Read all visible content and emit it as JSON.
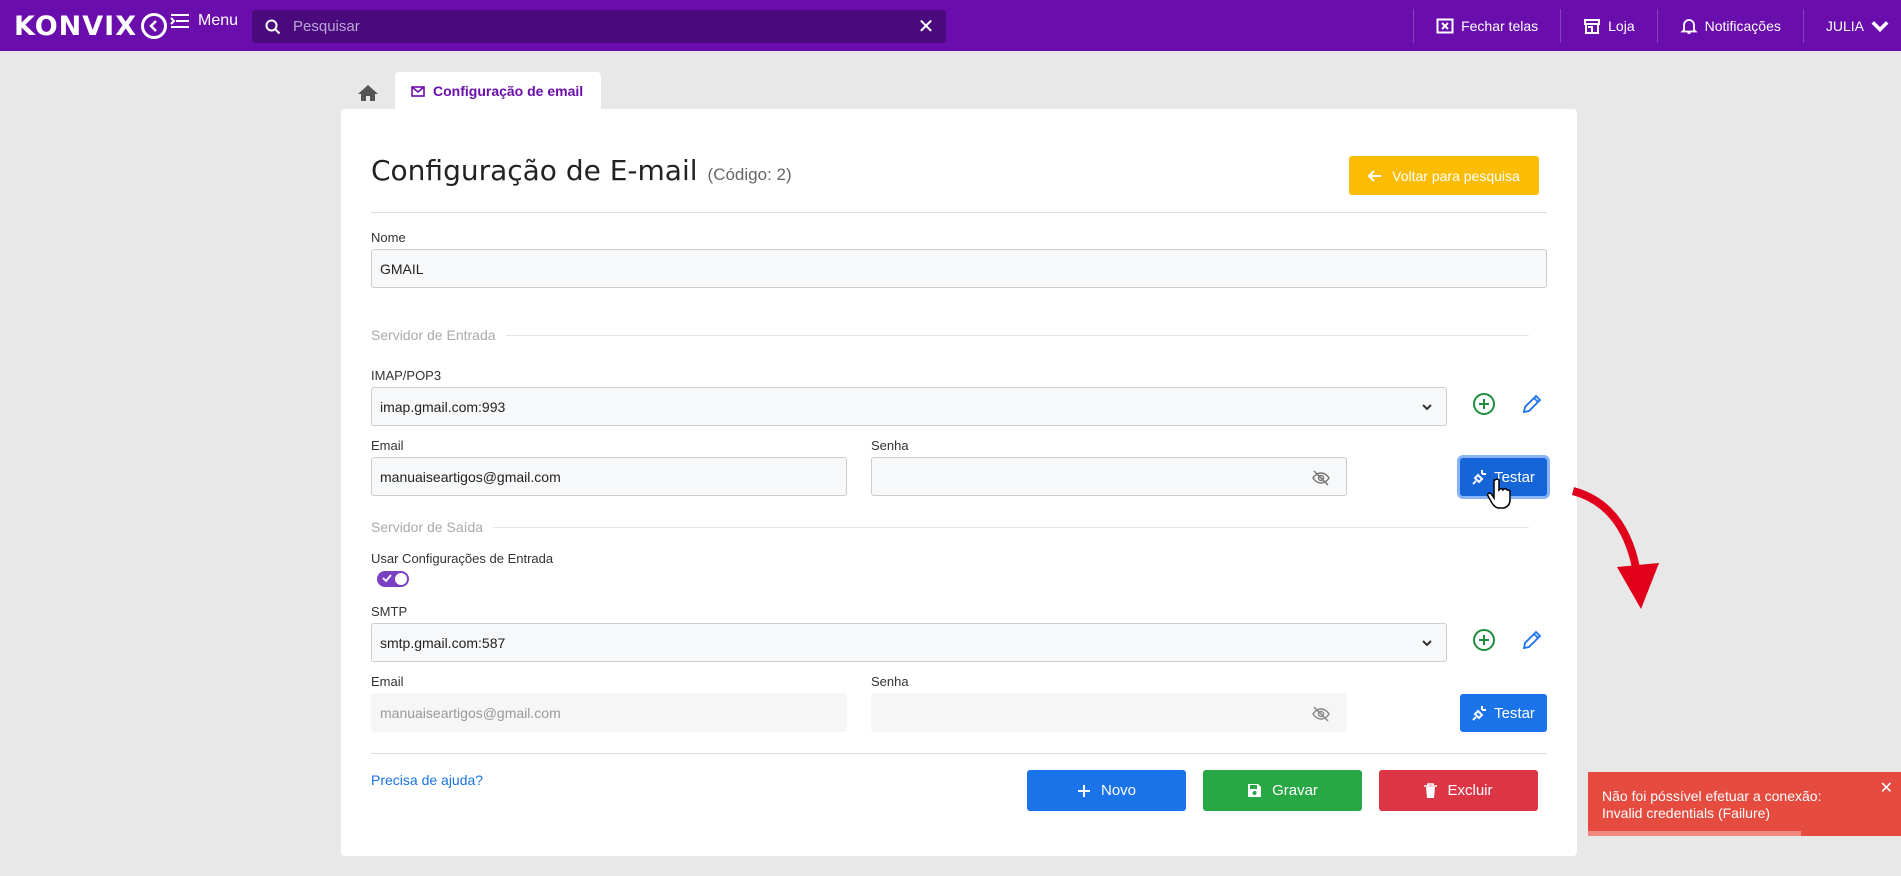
{
  "topbar": {
    "brand": "KONVIX",
    "menu_label": "Menu",
    "search": {
      "placeholder": "Pesquisar",
      "value": ""
    },
    "actions": [
      {
        "label": "Fechar telas",
        "icon": "close-window-icon"
      },
      {
        "label": "Loja",
        "icon": "store-icon"
      },
      {
        "label": "Notificações",
        "icon": "bell-icon"
      }
    ],
    "user": "JULIA"
  },
  "tabs": {
    "active_label": "Configuração de email"
  },
  "page": {
    "title": "Configuração de E-mail",
    "code_label": "(Código: 2)",
    "back_button": "Voltar para pesquisa"
  },
  "form": {
    "name_label": "Nome",
    "name_value": "GMAIL",
    "incoming": {
      "section_title": "Servidor de Entrada",
      "server_label": "IMAP/POP3",
      "server_value": "imap.gmail.com:993",
      "email_label": "Email",
      "email_value": "manuaiseartigos@gmail.com",
      "password_label": "Senha",
      "password_value": "",
      "test_button": "Testar"
    },
    "outgoing": {
      "section_title": "Servidor de Saída",
      "use_incoming_label": "Usar Configurações de Entrada",
      "use_incoming_enabled": true,
      "server_label": "SMTP",
      "server_value": "smtp.gmail.com:587",
      "email_label": "Email",
      "email_value": "manuaiseartigos@gmail.com",
      "password_label": "Senha",
      "password_value": "",
      "test_button": "Testar"
    }
  },
  "footer": {
    "help_link": "Precisa de ajuda?",
    "new_button": "Novo",
    "save_button": "Gravar",
    "delete_button": "Excluir"
  },
  "toast": {
    "message": "Não foi póssível efetuar a conexão: Invalid credentials (Failure)",
    "progress_remaining": 0.68
  },
  "colors": {
    "brand": "#6a0dad",
    "primary": "#1a73e8",
    "warning": "#fbbc04",
    "success": "#28a745",
    "danger": "#dc3545",
    "toast": "#e54b3f",
    "annotation": "#e0001b"
  }
}
